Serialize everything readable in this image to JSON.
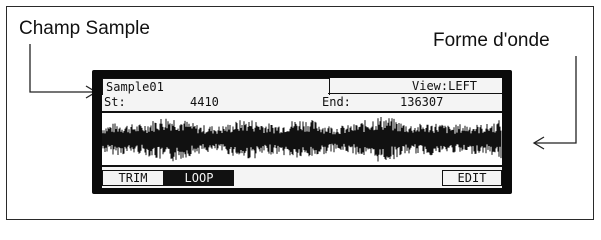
{
  "callouts": {
    "sample_field": "Champ Sample",
    "waveform": "Forme d'onde"
  },
  "screen": {
    "sample_name": "Sample01",
    "view_label": "View:LEFT",
    "start_label": "St:",
    "start_value": "4410",
    "end_label": "End:",
    "end_value": "136307"
  },
  "buttons": {
    "trim": "TRIM",
    "loop": "LOOP",
    "edit": "EDIT"
  },
  "waveform": {
    "description_icon": "waveform-display"
  }
}
